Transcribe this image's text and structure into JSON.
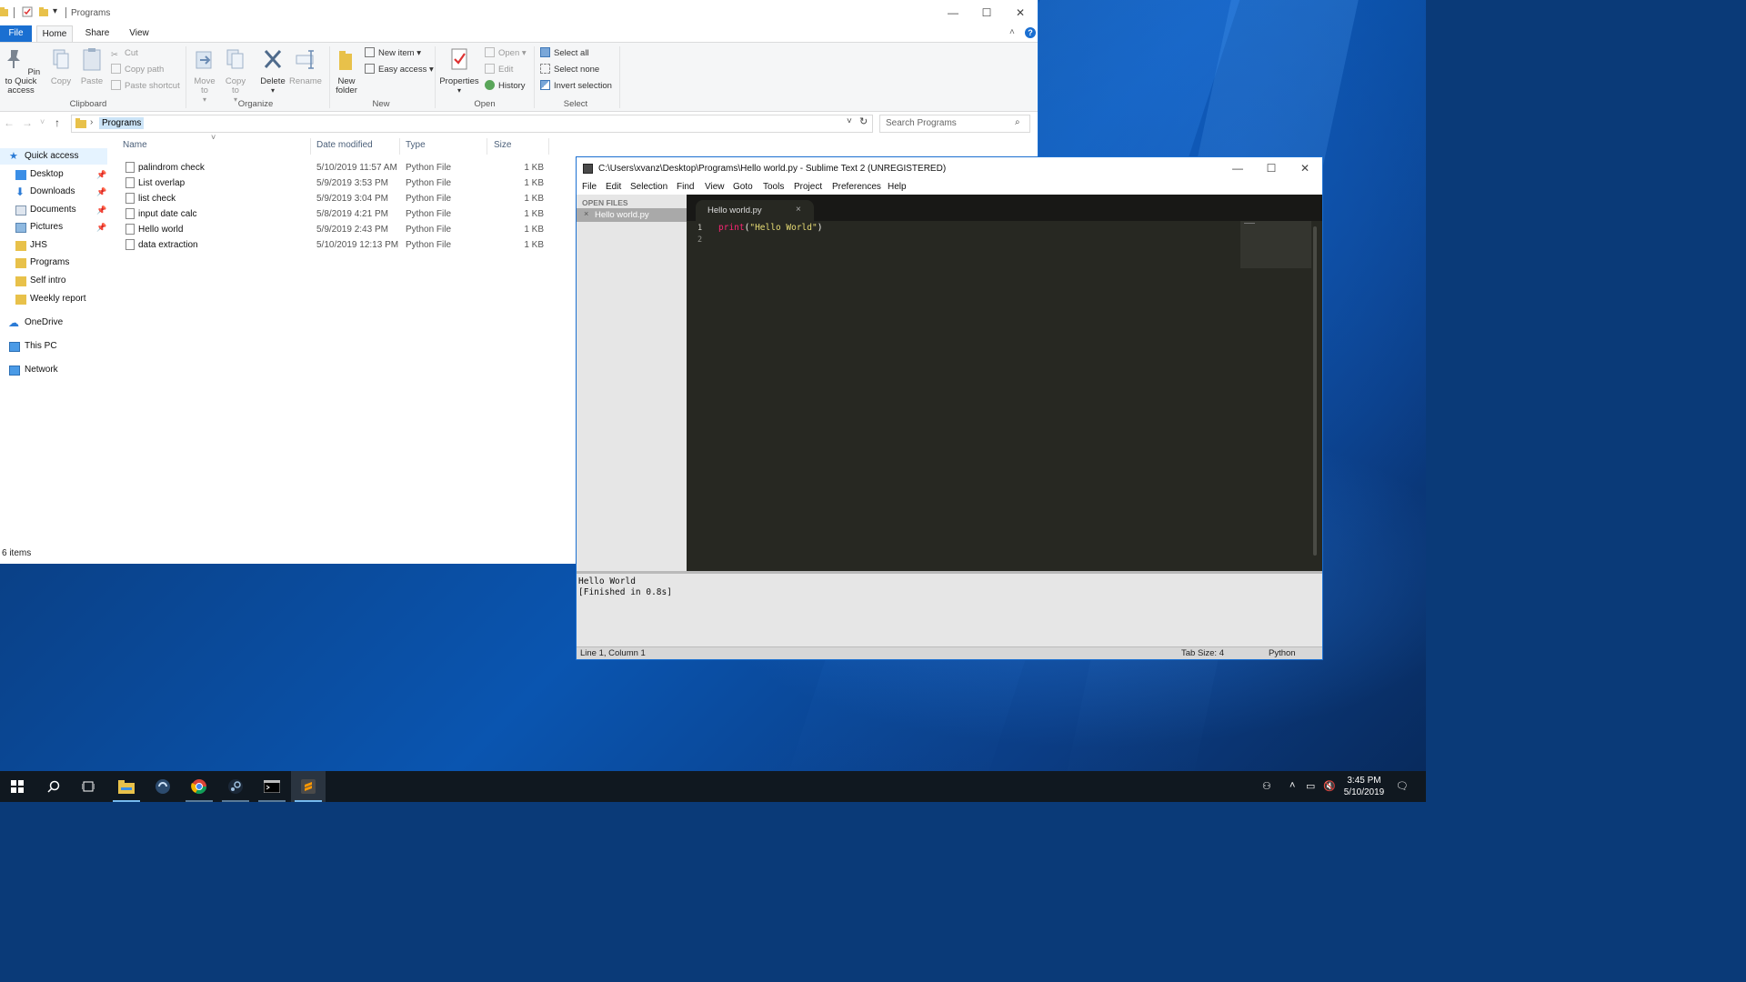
{
  "explorer": {
    "title": "Programs",
    "tabs": [
      "File",
      "Home",
      "Share",
      "View"
    ],
    "ribbon": {
      "clipboard": {
        "pin": "Pin to Quick access",
        "copy": "Copy",
        "paste": "Paste",
        "cut": "Cut",
        "copy_path": "Copy path",
        "paste_shortcut": "Paste shortcut",
        "label": "Clipboard"
      },
      "organize": {
        "move_to": "Move to",
        "copy_to": "Copy to",
        "delete": "Delete",
        "rename": "Rename",
        "label": "Organize"
      },
      "new": {
        "new_folder": "New folder",
        "new_item": "New item",
        "easy_access": "Easy access",
        "label": "New"
      },
      "open": {
        "properties": "Properties",
        "open": "Open",
        "edit": "Edit",
        "history": "History",
        "label": "Open"
      },
      "select": {
        "select_all": "Select all",
        "select_none": "Select none",
        "invert_selection": "Invert selection",
        "label": "Select"
      }
    },
    "address": {
      "crumb": "Programs"
    },
    "search_placeholder": "Search Programs",
    "nav": {
      "quick_access": "Quick access",
      "desktop": "Desktop",
      "downloads": "Downloads",
      "documents": "Documents",
      "pictures": "Pictures",
      "jhs": "JHS",
      "programs": "Programs",
      "self_intro": "Self intro",
      "weekly_report": "Weekly report",
      "onedrive": "OneDrive",
      "this_pc": "This PC",
      "network": "Network"
    },
    "columns": {
      "name": "Name",
      "date": "Date modified",
      "type": "Type",
      "size": "Size"
    },
    "files": [
      {
        "name": "palindrom check",
        "date": "5/10/2019 11:57 AM",
        "type": "Python File",
        "size": "1 KB"
      },
      {
        "name": "List overlap",
        "date": "5/9/2019 3:53 PM",
        "type": "Python File",
        "size": "1 KB"
      },
      {
        "name": "list check",
        "date": "5/9/2019 3:04 PM",
        "type": "Python File",
        "size": "1 KB"
      },
      {
        "name": "input date calc",
        "date": "5/8/2019 4:21 PM",
        "type": "Python File",
        "size": "1 KB"
      },
      {
        "name": "Hello world",
        "date": "5/9/2019 2:43 PM",
        "type": "Python File",
        "size": "1 KB"
      },
      {
        "name": "data extraction",
        "date": "5/10/2019 12:13 PM",
        "type": "Python File",
        "size": "1 KB"
      }
    ],
    "status": "6 items"
  },
  "sublime": {
    "title": "C:\\Users\\xvanz\\Desktop\\Programs\\Hello world.py - Sublime Text 2 (UNREGISTERED)",
    "menu": [
      "File",
      "Edit",
      "Selection",
      "Find",
      "View",
      "Goto",
      "Tools",
      "Project",
      "Preferences",
      "Help"
    ],
    "sidebar_header": "OPEN FILES",
    "open_file": "Hello world.py",
    "tab_name": "Hello world.py",
    "line_numbers": [
      "1",
      "2"
    ],
    "code": {
      "fn": "print",
      "open": "(",
      "str": "\"Hello World\"",
      "close": ")"
    },
    "console": [
      "Hello World",
      "[Finished in 0.8s]"
    ],
    "status_left": "Line 1, Column 1",
    "tab_size": "Tab Size: 4",
    "syntax": "Python"
  },
  "taskbar": {
    "time": "3:45 PM",
    "date": "5/10/2019"
  },
  "colors": {
    "accent": "#1a6fd1",
    "sublime_bg": "#272822",
    "keyword": "#f92672",
    "string": "#e6db74"
  }
}
